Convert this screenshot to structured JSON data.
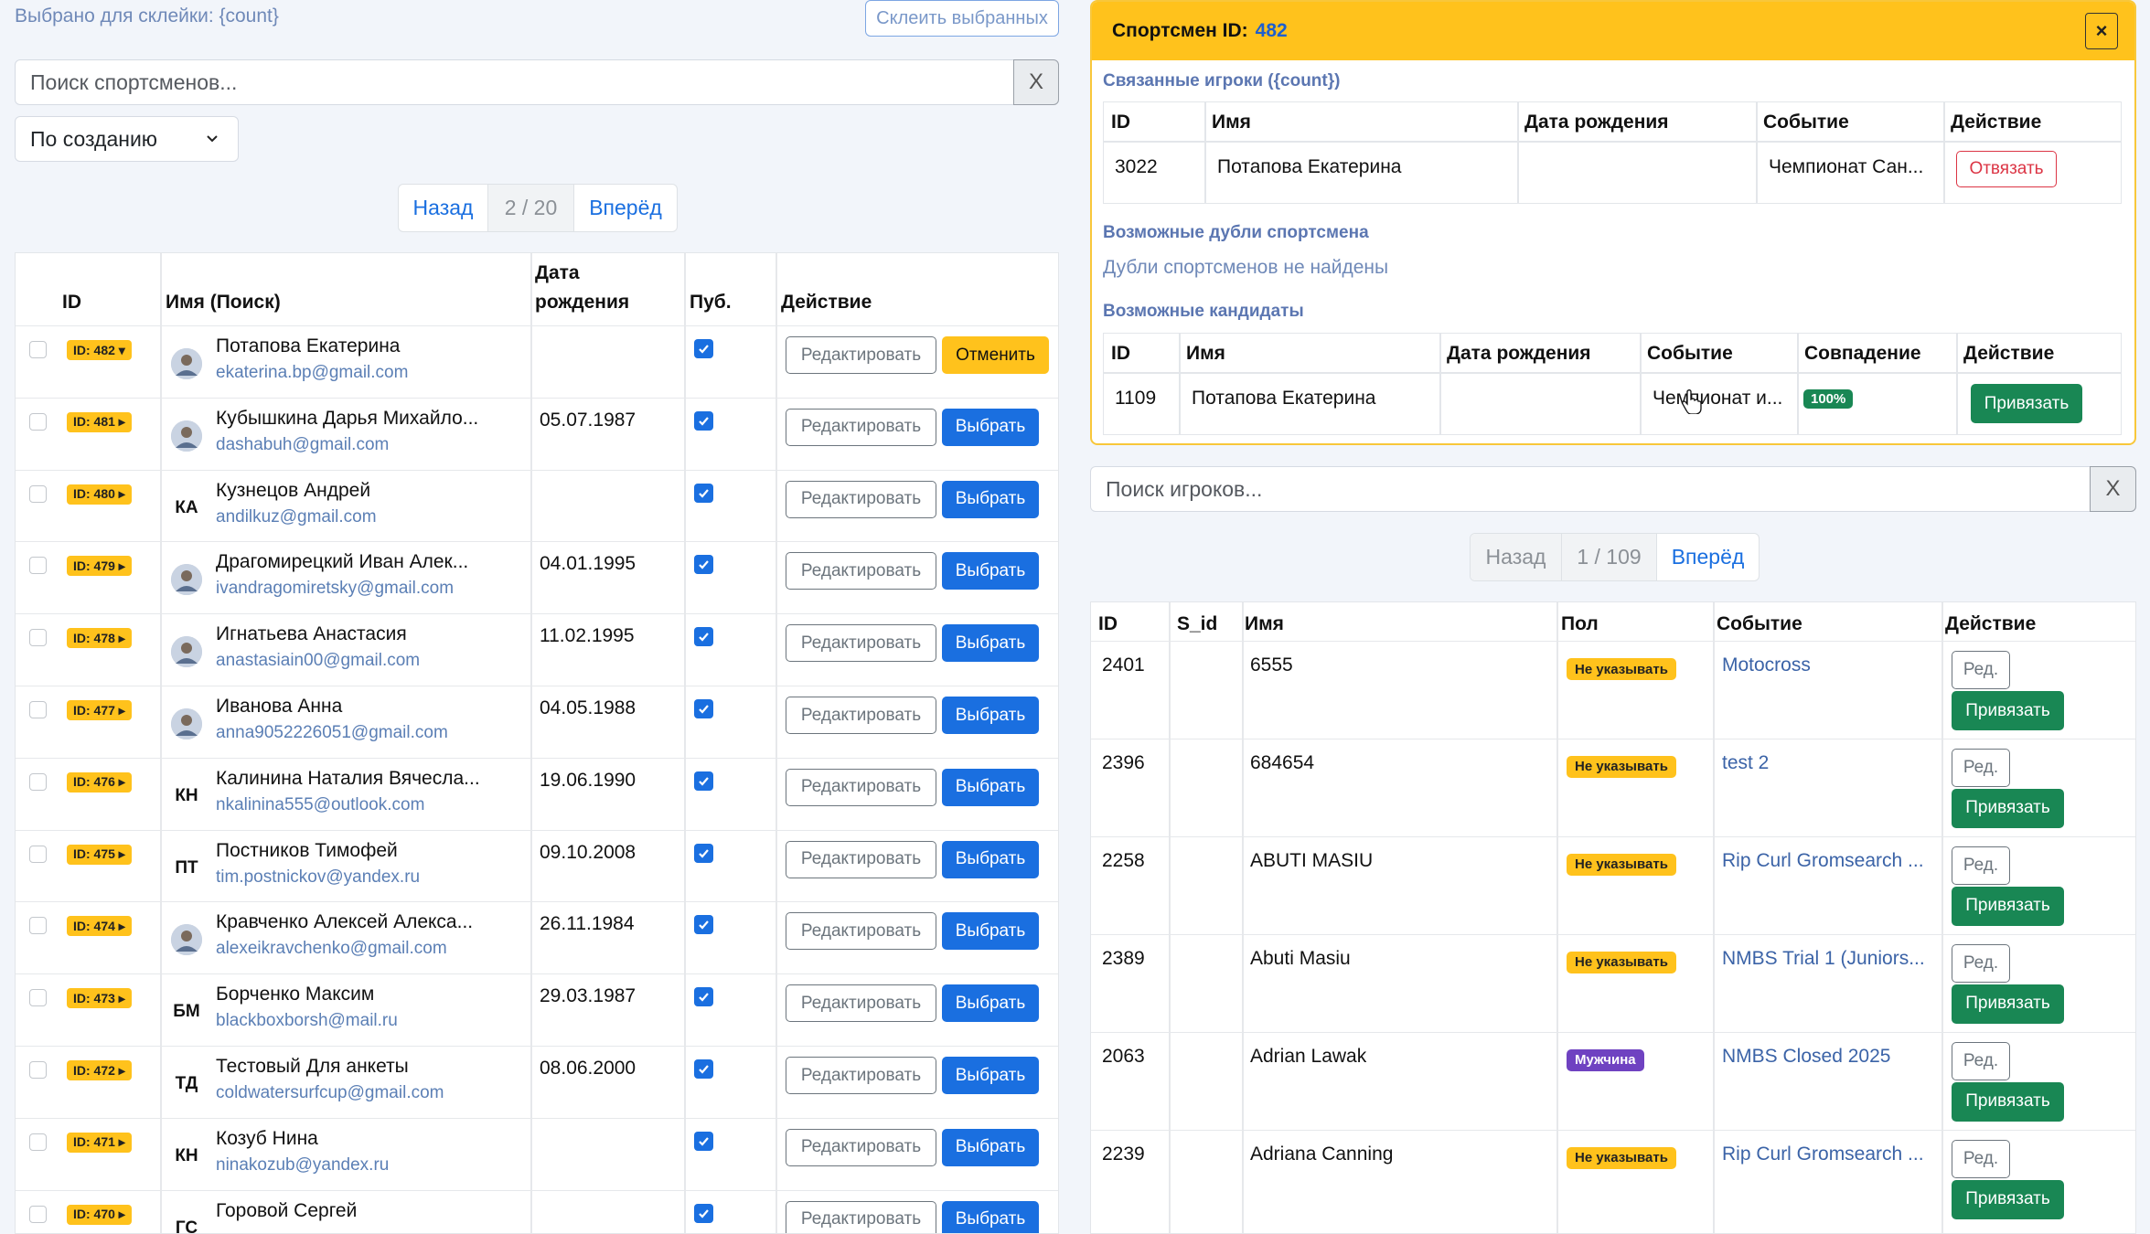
{
  "left": {
    "selected_label": "Выбрано для склейки: {count}",
    "merge_button": "Склеить выбранных",
    "search_placeholder": "Поиск спортсменов...",
    "clear": "X",
    "sort_value": "По созданию",
    "pager": {
      "prev": "Назад",
      "page": "2 / 20",
      "next": "Вперёд"
    },
    "columns": {
      "id": "ID",
      "name": "Имя (Поиск)",
      "dob_line1": "Дата",
      "dob_line2": "рождения",
      "pub": "Пуб.",
      "action": "Действие"
    },
    "edit_label": "Редактировать",
    "select_label": "Выбрать",
    "cancel_label": "Отменить",
    "rows": [
      {
        "id": "ID: 482 ▾",
        "name": "Потапова Екатерина",
        "email": "ekaterina.bp@gmail.com",
        "dob": "",
        "initials": "",
        "photo": true,
        "active": true
      },
      {
        "id": "ID: 481 ▸",
        "name": "Кубышкина Дарья Михайло...",
        "email": "dashabuh@gmail.com",
        "dob": "05.07.1987",
        "initials": "",
        "photo": true
      },
      {
        "id": "ID: 480 ▸",
        "name": "Кузнецов Андрей",
        "email": "andilkuz@gmail.com",
        "dob": "",
        "initials": "КА",
        "photo": false
      },
      {
        "id": "ID: 479 ▸",
        "name": "Драгомирецкий Иван Алек...",
        "email": "ivandragomiretsky@gmail.com",
        "dob": "04.01.1995",
        "initials": "",
        "photo": true
      },
      {
        "id": "ID: 478 ▸",
        "name": "Игнатьева Анастасия",
        "email": "anastasiain00@gmail.com",
        "dob": "11.02.1995",
        "initials": "",
        "photo": true
      },
      {
        "id": "ID: 477 ▸",
        "name": "Иванова Анна",
        "email": "anna9052226051@gmail.com",
        "dob": "04.05.1988",
        "initials": "",
        "photo": true
      },
      {
        "id": "ID: 476 ▸",
        "name": "Калинина Наталия Вячесла...",
        "email": "nkalinina555@outlook.com",
        "dob": "19.06.1990",
        "initials": "КН",
        "photo": false
      },
      {
        "id": "ID: 475 ▸",
        "name": "Постников Тимофей",
        "email": "tim.postnickov@yandex.ru",
        "dob": "09.10.2008",
        "initials": "ПТ",
        "photo": false
      },
      {
        "id": "ID: 474 ▸",
        "name": "Кравченко Алексей Алекса...",
        "email": "alexeikravchenko@gmail.com",
        "dob": "26.11.1984",
        "initials": "",
        "photo": true
      },
      {
        "id": "ID: 473 ▸",
        "name": "Борченко Максим",
        "email": "blackboxborsh@mail.ru",
        "dob": "29.03.1987",
        "initials": "БМ",
        "photo": false
      },
      {
        "id": "ID: 472 ▸",
        "name": "Тестовый Для анкеты",
        "email": "coldwatersurfcup@gmail.com",
        "dob": "08.06.2000",
        "initials": "ТД",
        "photo": false
      },
      {
        "id": "ID: 471 ▸",
        "name": "Козуб Нина",
        "email": "ninakozub@yandex.ru",
        "dob": "",
        "initials": "КН",
        "photo": false
      },
      {
        "id": "ID: 470 ▸",
        "name": "Горовой Сергей",
        "email": "",
        "dob": "",
        "initials": "ГС",
        "photo": false
      }
    ]
  },
  "detail": {
    "title": "Спортсмен ID:",
    "athlete_id": "482",
    "close": "×",
    "linked_title": "Связанные игроки ({count})",
    "linked_cols": {
      "id": "ID",
      "name": "Имя",
      "dob": "Дата рождения",
      "event": "Событие",
      "action": "Действие"
    },
    "linked_row": {
      "id": "3022",
      "name": "Потапова Екатерина",
      "dob": "",
      "event": "Чемпионат Сан...",
      "action": "Отвязать"
    },
    "dupes_title": "Возможные дубли спортсмена",
    "dupes_empty": "Дубли спортсменов не найдены",
    "cand_title": "Возможные кандидаты",
    "cand_cols": {
      "id": "ID",
      "name": "Имя",
      "dob": "Дата рождения",
      "event": "Событие",
      "match": "Совпадение",
      "action": "Действие"
    },
    "cand_row": {
      "id": "1109",
      "name": "Потапова Екатерина",
      "dob": "",
      "event": "Чемпионат и...",
      "match": "100%",
      "action": "Привязать"
    }
  },
  "players": {
    "search_placeholder": "Поиск игроков...",
    "clear": "X",
    "pager": {
      "prev": "Назад",
      "page": "1 / 109",
      "next": "Вперёд"
    },
    "cols": {
      "id": "ID",
      "sid": "S_id",
      "name": "Имя",
      "sex": "Пол",
      "event": "Событие",
      "action": "Действие"
    },
    "edit_label": "Ред.",
    "attach_label": "Привязать",
    "rows": [
      {
        "id": "2401",
        "name": "6555",
        "sex": "Не указывать",
        "sex_kind": "none",
        "event": "Motocross"
      },
      {
        "id": "2396",
        "name": "684654",
        "sex": "Не указывать",
        "sex_kind": "none",
        "event": "test 2"
      },
      {
        "id": "2258",
        "name": "ABUTI MASIU",
        "sex": "Не указывать",
        "sex_kind": "none",
        "event": "Rip Curl Gromsearch ..."
      },
      {
        "id": "2389",
        "name": "Abuti Masiu",
        "sex": "Не указывать",
        "sex_kind": "none",
        "event": "NMBS Trial 1 (Juniors..."
      },
      {
        "id": "2063",
        "name": "Adrian Lawak",
        "sex": "Мужчина",
        "sex_kind": "male",
        "event": "NMBS Closed 2025"
      },
      {
        "id": "2239",
        "name": "Adriana Canning",
        "sex": "Не указывать",
        "sex_kind": "none",
        "event": "Rip Curl Gromsearch ..."
      }
    ]
  },
  "colors": {
    "primary": "#1a6fe0",
    "warning": "#ffc21c",
    "success": "#198754",
    "danger": "#dc3545",
    "male_badge": "#6f42c1"
  }
}
